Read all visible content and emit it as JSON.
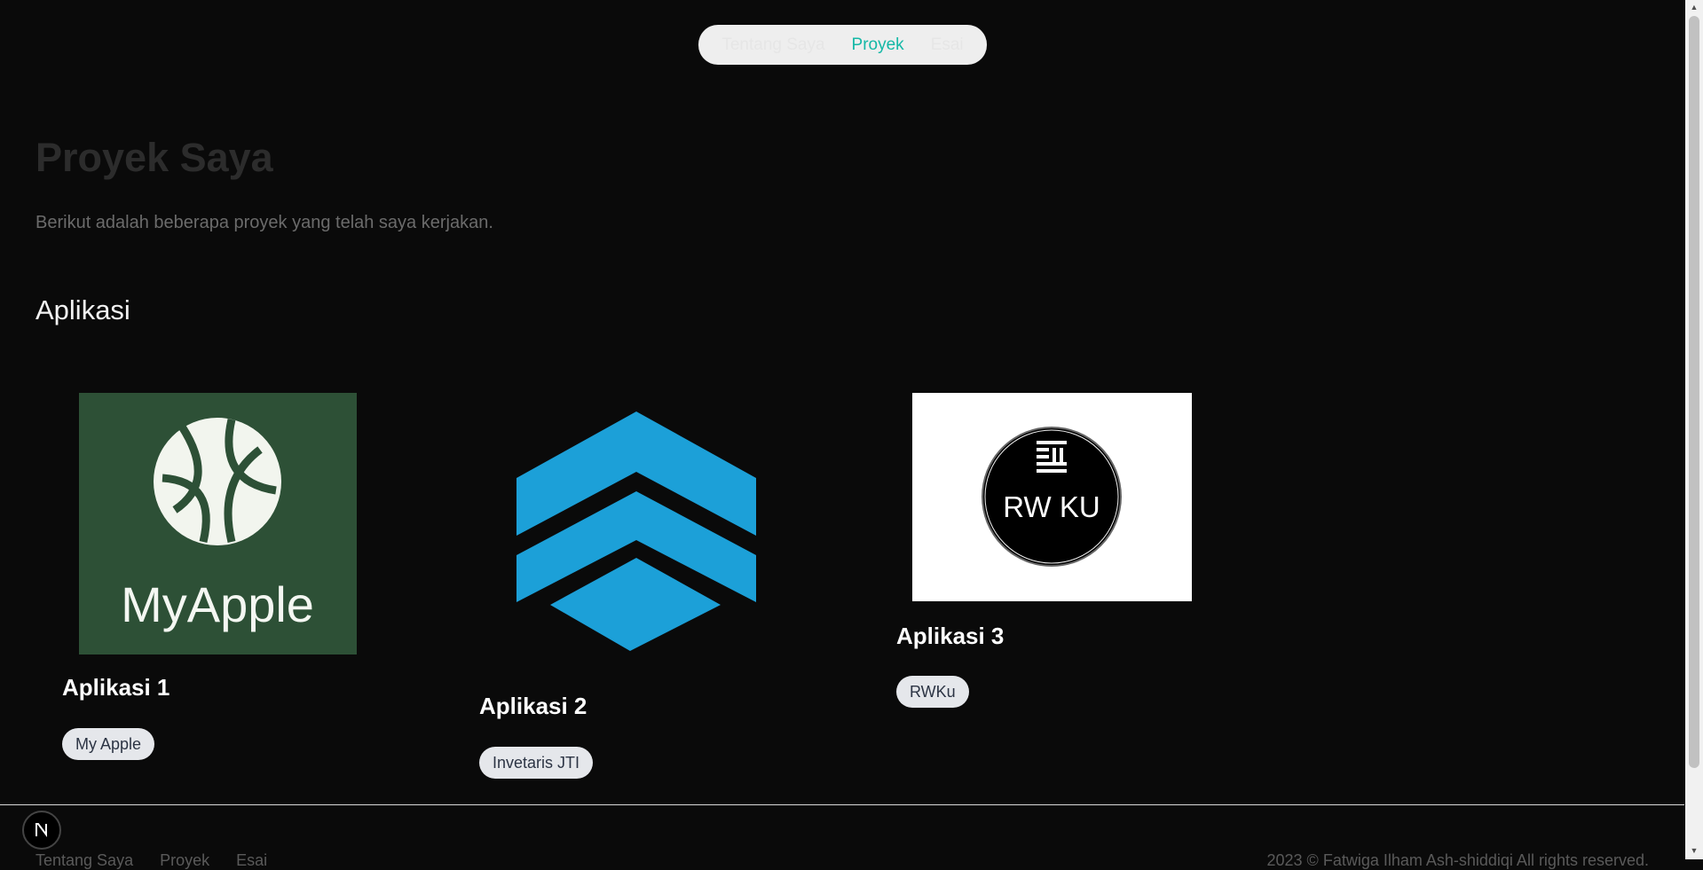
{
  "nav": {
    "links": [
      {
        "label": "Tentang Saya"
      },
      {
        "label": "Proyek"
      },
      {
        "label": "Esai"
      }
    ],
    "active": "Proyek"
  },
  "header": {
    "title": "Proyek Saya",
    "subtitle": "Berikut adalah beberapa proyek yang telah saya kerjakan."
  },
  "section": {
    "title": "Aplikasi"
  },
  "projects": [
    {
      "title": "Aplikasi 1",
      "tag": "My Apple",
      "image_text": "MyApple",
      "image_icon": "myapple-logo-icon"
    },
    {
      "title": "Aplikasi 2",
      "tag": "Invetaris JTI",
      "image_icon": "chevron-stack-logo-icon"
    },
    {
      "title": "Aplikasi 3",
      "tag": "RWKu",
      "image_text": "RW KU",
      "image_icon": "rwku-logo-icon"
    }
  ],
  "footer": {
    "links": [
      {
        "label": "Tentang Saya"
      },
      {
        "label": "Proyek"
      },
      {
        "label": "Esai"
      }
    ],
    "copyright": "2023 © Fatwiga Ilham Ash-shiddiqi All rights reserved."
  },
  "badge": {
    "letter": "N"
  },
  "colors": {
    "background": "#0a0a0a",
    "accent": "#14b8a6",
    "myapple_green": "#2d5036",
    "chevron_blue": "#1ca0d8",
    "tag_bg": "#e5e7eb"
  }
}
